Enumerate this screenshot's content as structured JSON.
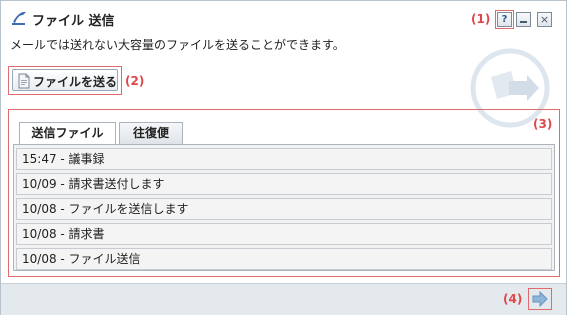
{
  "window": {
    "title": "ファイル 送信",
    "description": "メールでは送れない大容量のファイルを送ることができます。",
    "help_label": "?",
    "close_label": "×"
  },
  "callouts": {
    "c1": "(1)",
    "c2": "(2)",
    "c3": "(3)",
    "c4": "(4)"
  },
  "send_button": {
    "label": "ファイルを送る"
  },
  "tabs": [
    {
      "label": "送信ファイル",
      "active": true
    },
    {
      "label": "往復便",
      "active": false
    }
  ],
  "items": [
    {
      "text": "15:47 - 議事録"
    },
    {
      "text": "10/09 - 請求書送付します"
    },
    {
      "text": "10/08 - ファイルを送信します"
    },
    {
      "text": "10/08 - 請求書"
    },
    {
      "text": "10/08 - ファイル送信"
    }
  ],
  "icons": {
    "app": "file-send-icon",
    "send": "document-icon",
    "watermark": "file-send-watermark-icon",
    "next": "next-arrow-icon"
  },
  "colors": {
    "callout": "#e0474b",
    "accent": "#2e5b8f"
  }
}
